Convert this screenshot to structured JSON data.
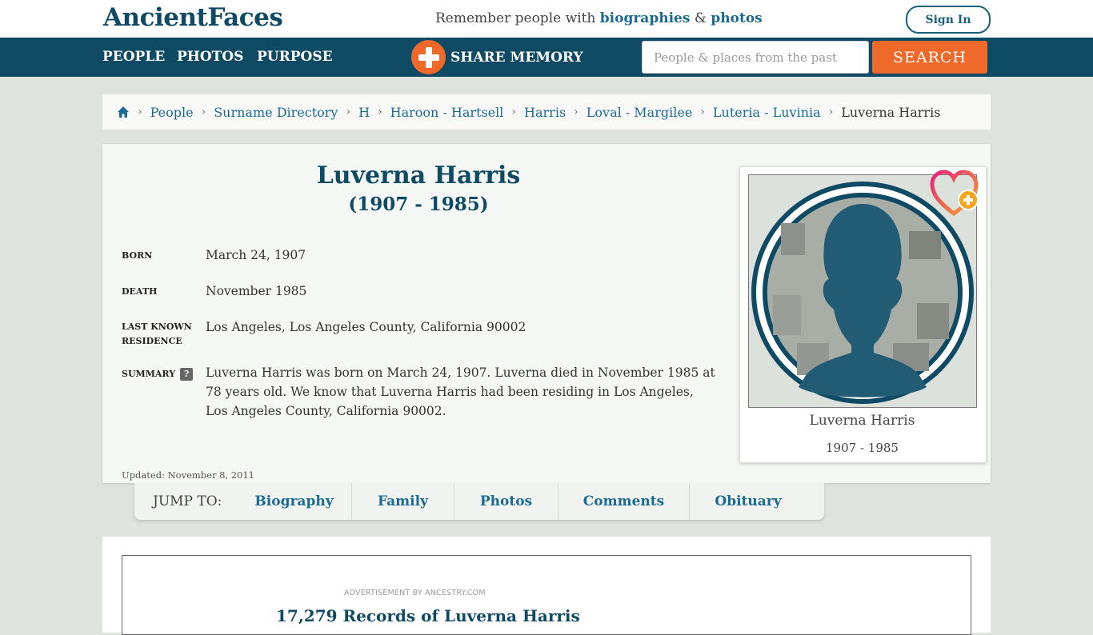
{
  "header": {
    "logo": "AncientFaces",
    "tagline_pre": "Remember people with ",
    "tagline_link1": "biographies",
    "tagline_mid": " & ",
    "tagline_link2": "photos",
    "signin_label": "Sign In"
  },
  "nav": {
    "items": [
      "PEOPLE",
      "PHOTOS",
      "PURPOSE"
    ],
    "share_label": "SHARE MEMORY",
    "search_placeholder": "People & places from the past",
    "search_button": "SEARCH"
  },
  "breadcrumb": {
    "items": [
      "People",
      "Surname Directory",
      "H",
      "Haroon - Hartsell",
      "Harris",
      "Loval - Margilee",
      "Luteria - Luvinia"
    ],
    "current": "Luverna Harris"
  },
  "person": {
    "name": "Luverna Harris",
    "years": "(1907 - 1985)",
    "facts": [
      {
        "label": "BORN",
        "value": "March 24, 1907"
      },
      {
        "label": "DEATH",
        "value": "November 1985"
      },
      {
        "label": "LAST KNOWN RESIDENCE",
        "value": "Los Angeles, Los Angeles County, California 90002"
      },
      {
        "label": "SUMMARY",
        "value": "Luverna Harris was born on March 24, 1907. Luverna died in November 1985 at 78 years old. We know that Luverna Harris had been residing in Los Angeles, Los Angeles County, California 90002."
      }
    ],
    "help_badge": "?",
    "updated": "Updated: November 8, 2011",
    "photo_name": "Luverna Harris",
    "photo_years": "1907 - 1985"
  },
  "jump": {
    "label": "JUMP TO:",
    "links": [
      "Biography",
      "Family",
      "Photos",
      "Comments",
      "Obituary"
    ]
  },
  "ad": {
    "label": "ADVERTISEMENT BY ANCESTRY.COM",
    "heading": "17,279 Records of Luverna Harris"
  },
  "colors": {
    "brand_dark": "#0f4a64",
    "accent_orange": "#ef6a2a",
    "link_blue": "#1a6a93"
  }
}
